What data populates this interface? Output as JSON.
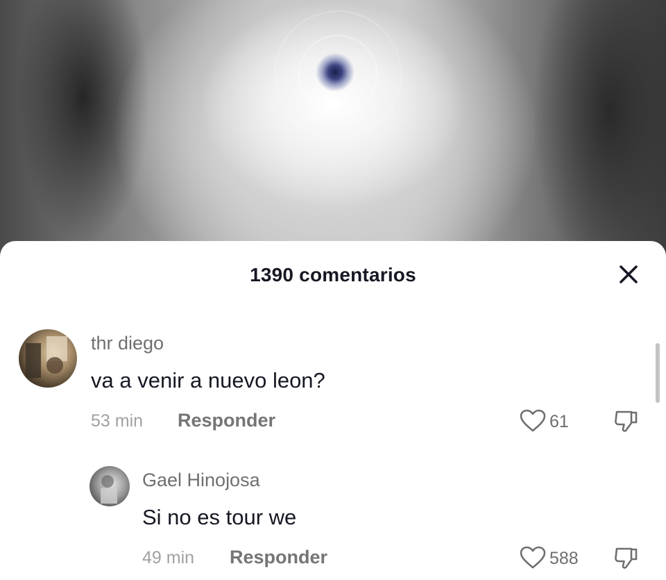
{
  "sheet": {
    "title": "1390 comentarios",
    "close_icon": "close-icon"
  },
  "comments": [
    {
      "username": "thr diego",
      "text": "va a venir a nuevo leon?",
      "time": "53 min",
      "reply_label": "Responder",
      "likes": "61",
      "avatar_icon": "avatar",
      "like_icon": "heart-outline-icon",
      "dislike_icon": "thumbs-down-icon"
    },
    {
      "username": "Gael Hinojosa",
      "text": "Si no es tour we",
      "time": "49 min",
      "reply_label": "Responder",
      "likes": "588",
      "avatar_icon": "avatar",
      "like_icon": "heart-outline-icon",
      "dislike_icon": "thumbs-down-icon"
    }
  ],
  "colors": {
    "text_primary": "#161823",
    "text_secondary": "#6f6f6f",
    "text_muted": "#a1a1a1",
    "sheet_bg": "#ffffff"
  }
}
